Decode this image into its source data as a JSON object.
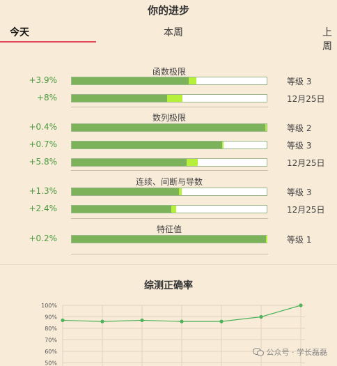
{
  "header": {
    "title": "你的进步"
  },
  "tabs": [
    {
      "label": "今天",
      "active": true
    },
    {
      "label": "本周",
      "active": false
    },
    {
      "label": "上周",
      "active": false
    }
  ],
  "sections": [
    {
      "title": "函数极限",
      "rows": [
        {
          "pct_label": "+3.9%",
          "base": 0.6,
          "gain": 0.039,
          "right": "等级 3"
        },
        {
          "pct_label": "+8%",
          "base": 0.49,
          "gain": 0.08,
          "right": "12月25日"
        }
      ]
    },
    {
      "title": "数列极限",
      "rows": [
        {
          "pct_label": "+0.4%",
          "base": 0.992,
          "gain": 0.004,
          "right": "等级 2"
        },
        {
          "pct_label": "+0.7%",
          "base": 0.77,
          "gain": 0.007,
          "right": "等级 3"
        },
        {
          "pct_label": "+5.8%",
          "base": 0.59,
          "gain": 0.058,
          "right": "12月25日"
        }
      ]
    },
    {
      "title": "连续、间断与导数",
      "rows": [
        {
          "pct_label": "+1.3%",
          "base": 0.55,
          "gain": 0.013,
          "right": "等级 3"
        },
        {
          "pct_label": "+2.4%",
          "base": 0.51,
          "gain": 0.024,
          "right": "12月25日"
        }
      ]
    },
    {
      "title": "特征值",
      "rows": [
        {
          "pct_label": "+0.2%",
          "base": 0.996,
          "gain": 0.002,
          "right": "等级 1"
        }
      ]
    }
  ],
  "chart_data": {
    "type": "line",
    "title": "综测正确率",
    "y_ticks": [
      "100%",
      "90%",
      "80%",
      "70%",
      "60%",
      "50%"
    ],
    "ylim": [
      50,
      100
    ],
    "x": [
      1,
      2,
      3,
      4,
      5,
      6,
      7
    ],
    "values": [
      87,
      86,
      87,
      86,
      86,
      90,
      100
    ],
    "grid": true
  },
  "colors": {
    "bar_base": "#7cb35a",
    "bar_gain": "#b6f03a",
    "line": "#4cb35a",
    "tab_indicator": "#e04a5a",
    "percent_text": "#4a9a3e"
  },
  "watermark": {
    "text": "公众号 · 学长磊磊",
    "icon": "wechat-icon"
  }
}
